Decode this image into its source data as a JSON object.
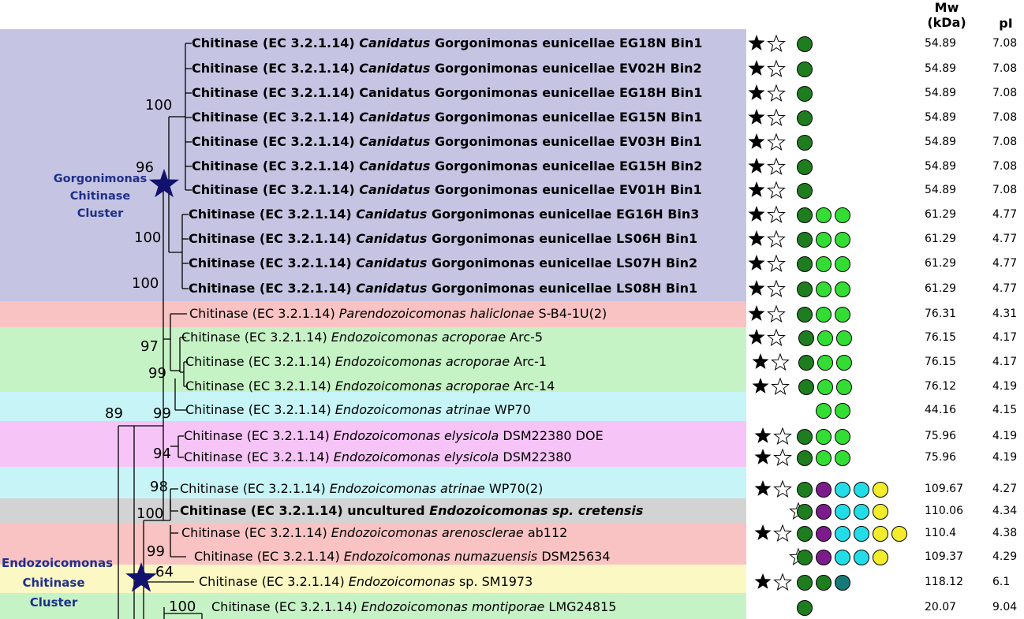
{
  "header": {
    "mw_line1": "Mw",
    "mw_line2": "(kDa)",
    "pi": "pI"
  },
  "clusters": {
    "gorgonimonas": [
      "Gorgonimonas",
      "Chitinase",
      "Cluster"
    ],
    "endozoicomonas": [
      "Endozoicomonas",
      "Chitinase",
      "Cluster"
    ]
  },
  "bootstrap": {
    "b100a": "100",
    "b96": "96",
    "b100b": "100",
    "b100c": "100",
    "b97": "97",
    "b99a": "99",
    "b89": "89",
    "b99b": "99",
    "b94": "94",
    "b98": "98",
    "b100d": "100",
    "b99c": "99",
    "b64": "64",
    "b100e": "100"
  },
  "colors": {
    "band_purple": "#c5c5e3",
    "band_pink": "#f9c3c3",
    "band_green": "#c6f3c6",
    "band_cyan": "#c7f5f7",
    "band_magenta": "#f6c4f6",
    "band_gray": "#d3d3d3",
    "band_yellow": "#fbf8c3",
    "dark_green": "#1e7d1e",
    "light_green": "#33dd33",
    "purple": "#7c1c8c",
    "cyan": "#22dde8",
    "yellow": "#f2ec2a",
    "teal": "#167a78",
    "star_blue": "#12126e"
  },
  "leaves": [
    {
      "pre": "Chitinase (EC 3.2.1.14) ",
      "it": "Canidatus",
      "post": " Gorgonimonas eunicellae EG18N Bin1",
      "bold": true,
      "stars": [
        1,
        1
      ],
      "dots": [
        "dark_green"
      ],
      "mw": "54.89",
      "pi": "7.08"
    },
    {
      "pre": "Chitinase (EC 3.2.1.14) ",
      "it": "Canidatus",
      "post": " Gorgonimonas eunicellae EV02H Bin2",
      "bold": true,
      "stars": [
        1,
        1
      ],
      "dots": [
        "dark_green"
      ],
      "mw": "54.89",
      "pi": "7.08"
    },
    {
      "pre": "Chitinase (EC 3.2.1.14) Canidatus Gorgonimonas eunicellae EG18H Bin1",
      "it": "",
      "post": "",
      "bold": true,
      "stars": [
        1,
        1
      ],
      "dots": [
        "dark_green"
      ],
      "mw": "54.89",
      "pi": "7.08"
    },
    {
      "pre": "Chitinase (EC 3.2.1.14) ",
      "it": "Canidatus",
      "post": " Gorgonimonas eunicellae  EG15N Bin1",
      "bold": true,
      "stars": [
        1,
        1
      ],
      "dots": [
        "dark_green"
      ],
      "mw": "54.89",
      "pi": "7.08"
    },
    {
      "pre": "Chitinase (EC 3.2.1.14) ",
      "it": "Canidatus",
      "post": " Gorgonimonas eunicellae  EV03H Bin1",
      "bold": true,
      "stars": [
        1,
        1
      ],
      "dots": [
        "dark_green"
      ],
      "mw": "54.89",
      "pi": "7.08"
    },
    {
      "pre": "Chitinase (EC 3.2.1.14) ",
      "it": "Canidatus",
      "post": " Gorgonimonas eunicellae EG15H Bin2",
      "bold": true,
      "stars": [
        1,
        1
      ],
      "dots": [
        "dark_green"
      ],
      "mw": "54.89",
      "pi": "7.08"
    },
    {
      "pre": "Chitinase (EC 3.2.1.14) ",
      "it": "Canidatus",
      "post": " Gorgonimonas eunicellae  EV01H Bin1",
      "bold": true,
      "stars": [
        1,
        1
      ],
      "dots": [
        "dark_green"
      ],
      "mw": "54.89",
      "pi": "7.08"
    },
    {
      "pre": "Chitinase (EC 3.2.1.14) ",
      "it": "Canidatus",
      "post": " Gorgonimonas eunicellae EG16H Bin3",
      "bold": true,
      "stars": [
        1,
        1
      ],
      "dots": [
        "dark_green",
        "light_green",
        "light_green"
      ],
      "mw": "61.29",
      "pi": "4.77"
    },
    {
      "pre": "Chitinase (EC 3.2.1.14) ",
      "it": "Canidatus",
      "post": " Gorgonimonas eunicellae LS06H Bin1",
      "bold": true,
      "stars": [
        1,
        1
      ],
      "dots": [
        "dark_green",
        "light_green",
        "light_green"
      ],
      "mw": "61.29",
      "pi": "4.77"
    },
    {
      "pre": "Chitinase (EC 3.2.1.14) ",
      "it": "Canidatus",
      "post": " Gorgonimonas eunicellae LS07H Bin2",
      "bold": true,
      "stars": [
        1,
        1
      ],
      "dots": [
        "dark_green",
        "light_green",
        "light_green"
      ],
      "mw": "61.29",
      "pi": "4.77"
    },
    {
      "pre": "Chitinase (EC 3.2.1.14) ",
      "it": "Canidatus",
      "post": " Gorgonimonas eunicellae LS08H Bin1",
      "bold": true,
      "stars": [
        1,
        1
      ],
      "dots": [
        "dark_green",
        "light_green",
        "light_green"
      ],
      "mw": "61.29",
      "pi": "4.77"
    },
    {
      "pre": "Chitinase (EC 3.2.1.14) ",
      "it": "Parendozoicomonas haliclonae",
      "post": " S-B4-1U(2)",
      "bold": false,
      "stars": [
        1,
        1
      ],
      "dots": [
        "dark_green",
        "light_green",
        "light_green"
      ],
      "mw": "76.31",
      "pi": "4.31"
    },
    {
      "pre": "Chitinase (EC 3.2.1.14) ",
      "it": "Endozoicomonas acroporae",
      "post": " Arc-5",
      "bold": false,
      "stars": [
        1,
        1
      ],
      "dots": [
        "dark_green",
        "light_green",
        "light_green"
      ],
      "mw": "76.15",
      "pi": "4.17"
    },
    {
      "pre": "Chitinase (EC 3.2.1.14) ",
      "it": "Endozoicomonas acroporae",
      "post": " Arc-1",
      "bold": false,
      "stars": [
        1,
        1
      ],
      "dots": [
        "dark_green",
        "light_green",
        "light_green"
      ],
      "mw": "76.15",
      "pi": "4.17"
    },
    {
      "pre": "Chitinase (EC 3.2.1.14) ",
      "it": "Endozoicomonas acroporae",
      "post": " Arc-14",
      "bold": false,
      "stars": [
        1,
        1
      ],
      "dots": [
        "dark_green",
        "light_green",
        "light_green"
      ],
      "mw": "76.12",
      "pi": "4.19"
    },
    {
      "pre": "Chitinase (EC 3.2.1.14) ",
      "it": "Endozoicomonas atrinae",
      "post": " WP70",
      "bold": false,
      "stars": [
        0,
        0
      ],
      "dots": [
        "light_green",
        "light_green"
      ],
      "mw": "44.16",
      "pi": "4.15"
    },
    {
      "pre": "Chitinase (EC 3.2.1.14) ",
      "it": "Endozoicomonas elysicola",
      "post": " DSM22380 DOE",
      "bold": false,
      "stars": [
        1,
        1
      ],
      "dots": [
        "dark_green",
        "light_green",
        "light_green"
      ],
      "mw": "75.96",
      "pi": "4.19"
    },
    {
      "pre": "Chitinase (EC 3.2.1.14) ",
      "it": "Endozoicomonas elysicola",
      "post": " DSM22380",
      "bold": false,
      "stars": [
        1,
        1
      ],
      "dots": [
        "dark_green",
        "light_green",
        "light_green"
      ],
      "mw": "75.96",
      "pi": "4.19"
    },
    {
      "pre": "Chitinase (EC 3.2.1.14) ",
      "it": "Endozoicomonas atrinae",
      "post": " WP70(2)",
      "bold": false,
      "stars": [
        1,
        1
      ],
      "dots": [
        "dark_green",
        "purple",
        "cyan",
        "cyan",
        "yellow"
      ],
      "mw": "109.67",
      "pi": "4.27"
    },
    {
      "pre": "Chitinase (EC 3.2.1.14) uncultured ",
      "it": "Endozoicomonas sp. cretensis",
      "post": "",
      "bold": true,
      "stars": [
        0,
        1
      ],
      "dots": [
        "dark_green",
        "purple",
        "cyan",
        "cyan",
        "yellow"
      ],
      "mw": "110.06",
      "pi": "4.34"
    },
    {
      "pre": "Chitinase (EC 3.2.1.14) ",
      "it": "Endozoicomonas arenosclerae",
      "post": " ab112",
      "bold": false,
      "stars": [
        1,
        1
      ],
      "dots": [
        "dark_green",
        "purple",
        "cyan",
        "cyan",
        "yellow",
        "yellow"
      ],
      "mw": "110.4",
      "pi": "4.38"
    },
    {
      "pre": "Chitinase (EC 3.2.1.14) ",
      "it": "Endozoicomonas numazuensis",
      "post": " DSM25634",
      "bold": false,
      "stars": [
        0,
        1
      ],
      "dots": [
        "dark_green",
        "purple",
        "cyan",
        "cyan",
        "yellow"
      ],
      "mw": "109.37",
      "pi": "4.29"
    },
    {
      "pre": "Chitinase (EC 3.2.1.14) ",
      "it": "Endozoicomonas",
      "post": " sp. SM1973",
      "bold": false,
      "stars": [
        1,
        1
      ],
      "dots": [
        "dark_green",
        "dark_green",
        "teal"
      ],
      "mw": "118.12",
      "pi": "6.1"
    },
    {
      "pre": "Chitinase (EC 3.2.1.14) ",
      "it": "Endozoicomonas montiporae",
      "post": " LMG24815",
      "bold": false,
      "stars": [
        0,
        0
      ],
      "dots": [
        "dark_green"
      ],
      "mw": "20.07",
      "pi": "9.04"
    }
  ]
}
